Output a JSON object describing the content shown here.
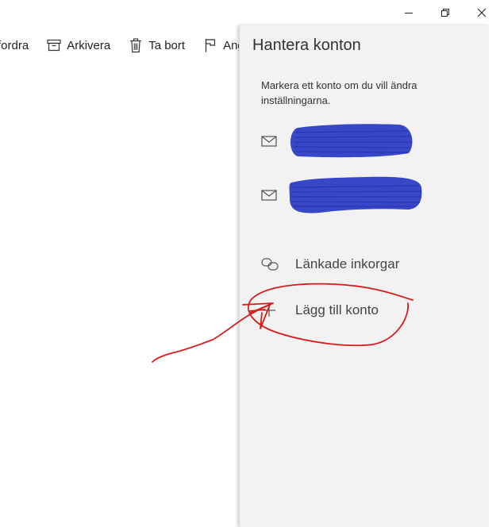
{
  "toolbar": {
    "items": [
      {
        "label": "fordra",
        "icon": "forward-icon"
      },
      {
        "label": "Arkivera",
        "icon": "archive-icon"
      },
      {
        "label": "Ta bort",
        "icon": "trash-icon"
      },
      {
        "label": "Ang",
        "icon": "flag-icon"
      }
    ]
  },
  "window": {
    "controls": [
      "minimize-icon",
      "restore-icon",
      "close-icon"
    ]
  },
  "panel": {
    "title": "Hantera konton",
    "hint": "Markera ett konto om du vill ändra inställningarna.",
    "accounts": [
      {
        "icon": "mail-icon",
        "redaction_color": "#3846c8"
      },
      {
        "icon": "mail-icon",
        "redaction_color": "#3846c8"
      }
    ],
    "linked_inboxes": {
      "label": "Länkade inkorgar",
      "icon": "link-icon"
    },
    "add_account": {
      "label": "Lägg till konto",
      "icon": "plus-icon"
    }
  },
  "annotation": {
    "color": "#d81a1a"
  }
}
